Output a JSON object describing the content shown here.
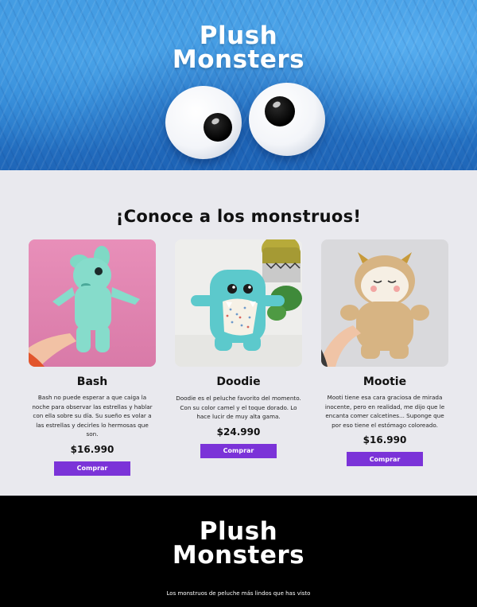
{
  "brand": {
    "line1": "Plush",
    "line2": "Monsters"
  },
  "section": {
    "title": "¡Conoce a los monstruos!"
  },
  "products": [
    {
      "name": "Bash",
      "description": "Bash no puede esperar a que caiga la noche para observar las estrellas y hablar con ella sobre su día. Su sueño es volar a las estrellas y decirles lo hermosas que son.",
      "price": "$16.990",
      "button": "Comprar"
    },
    {
      "name": "Doodie",
      "description": "Doodie es el peluche favorito del momento. Con su color camel y el toque dorado. Lo hace lucir de muy alta gama.",
      "price": "$24.990",
      "button": "Comprar"
    },
    {
      "name": "Mootie",
      "description": "Mooti tiene esa cara graciosa de mirada inocente, pero en realidad, me dijo que le encanta comer calcetines... Suponge que por eso tiene el estómago coloreado.",
      "price": "$16.990",
      "button": "Comprar"
    }
  ],
  "footer": {
    "tagline": "Los monstruos de peluche más lindos que has visto"
  },
  "colors": {
    "accent": "#7b33d8",
    "hero_blue": "#2a7fd0",
    "page_bg": "#e9e9ee",
    "footer_bg": "#000000"
  }
}
